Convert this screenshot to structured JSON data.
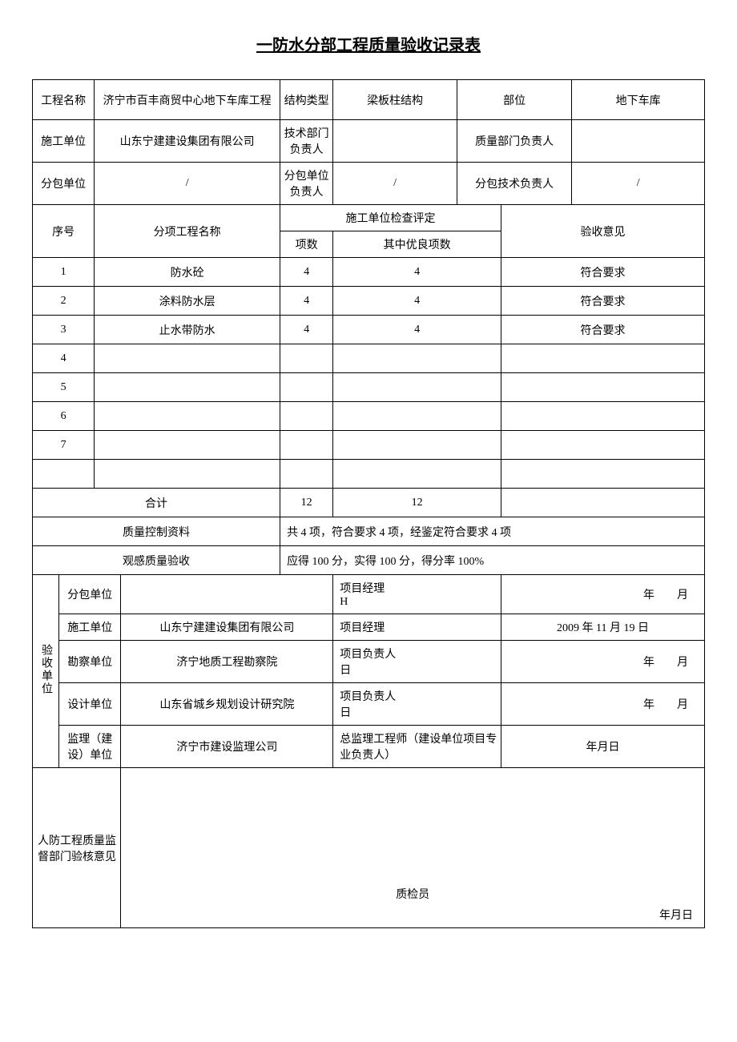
{
  "title": "一防水分部工程质量验收记录表",
  "headers": {
    "project_name_label": "工程名称",
    "project_name": "济宁市百丰商贸中心地下车库工程",
    "structure_type_label": "结构类型",
    "structure_type": "梁板柱结构",
    "location_label": "部位",
    "location": "地下车库",
    "construction_unit_label": "施工单位",
    "construction_unit": "山东宁建建设集团有限公司",
    "tech_dept_head_label": "技术部门负责人",
    "tech_dept_head": "",
    "quality_dept_head_label": "质量部门负责人",
    "quality_dept_head": "",
    "subcontract_unit_label": "分包单位",
    "subcontract_unit": "/",
    "subcontract_head_label": "分包单位负责人",
    "subcontract_head": "/",
    "subcontract_tech_head_label": "分包技术负责人",
    "subcontract_tech_head": "/"
  },
  "table_headers": {
    "seq": "序号",
    "sub_item_name": "分项工程名称",
    "inspection_group": "施工单位检查评定",
    "item_count": "项数",
    "excellent_count": "其中优良项数",
    "acceptance_opinion": "验收意见"
  },
  "rows": [
    {
      "seq": "1",
      "name": "防水砼",
      "count": "4",
      "excellent": "4",
      "opinion": "符合要求"
    },
    {
      "seq": "2",
      "name": "涂料防水层",
      "count": "4",
      "excellent": "4",
      "opinion": "符合要求"
    },
    {
      "seq": "3",
      "name": "止水带防水",
      "count": "4",
      "excellent": "4",
      "opinion": "符合要求"
    },
    {
      "seq": "4",
      "name": "",
      "count": "",
      "excellent": "",
      "opinion": ""
    },
    {
      "seq": "5",
      "name": "",
      "count": "",
      "excellent": "",
      "opinion": ""
    },
    {
      "seq": "6",
      "name": "",
      "count": "",
      "excellent": "",
      "opinion": ""
    },
    {
      "seq": "7",
      "name": "",
      "count": "",
      "excellent": "",
      "opinion": ""
    }
  ],
  "totals": {
    "label": "合计",
    "count": "12",
    "excellent": "12"
  },
  "quality_control": {
    "label": "质量控制资料",
    "value": "共 4 项，符合要求 4 项，经鉴定符合要求 4 项"
  },
  "visual_quality": {
    "label": "观感质量验收",
    "value": "应得 100 分，实得 100 分，得分率 100%"
  },
  "acceptance_units": {
    "group_label": "验收单位",
    "subcontract": {
      "label": "分包单位",
      "value": "",
      "role": "项目经理",
      "role_sub": "H",
      "date": "年　　月"
    },
    "construction": {
      "label": "施工单位",
      "value": "山东宁建建设集团有限公司",
      "role": "项目经理",
      "date": "2009 年 11 月 19 日"
    },
    "survey": {
      "label": "勘察单位",
      "value": "济宁地质工程勘察院",
      "role": "项目负责人",
      "role_sub": "日",
      "date": "年　　月"
    },
    "design": {
      "label": "设计单位",
      "value": "山东省城乡规划设计研究院",
      "role": "项目负责人",
      "role_sub": "日",
      "date": "年　　月"
    },
    "supervision": {
      "label": "监理（建设）单位",
      "value": "济宁市建设监理公司",
      "role": "总监理工程师（建设单位项目专业负责人）",
      "date": "年月日"
    }
  },
  "defense_opinion": {
    "label": "人防工程质量监督部门验核意见",
    "inspector_label": "质检员",
    "date": "年月日"
  }
}
